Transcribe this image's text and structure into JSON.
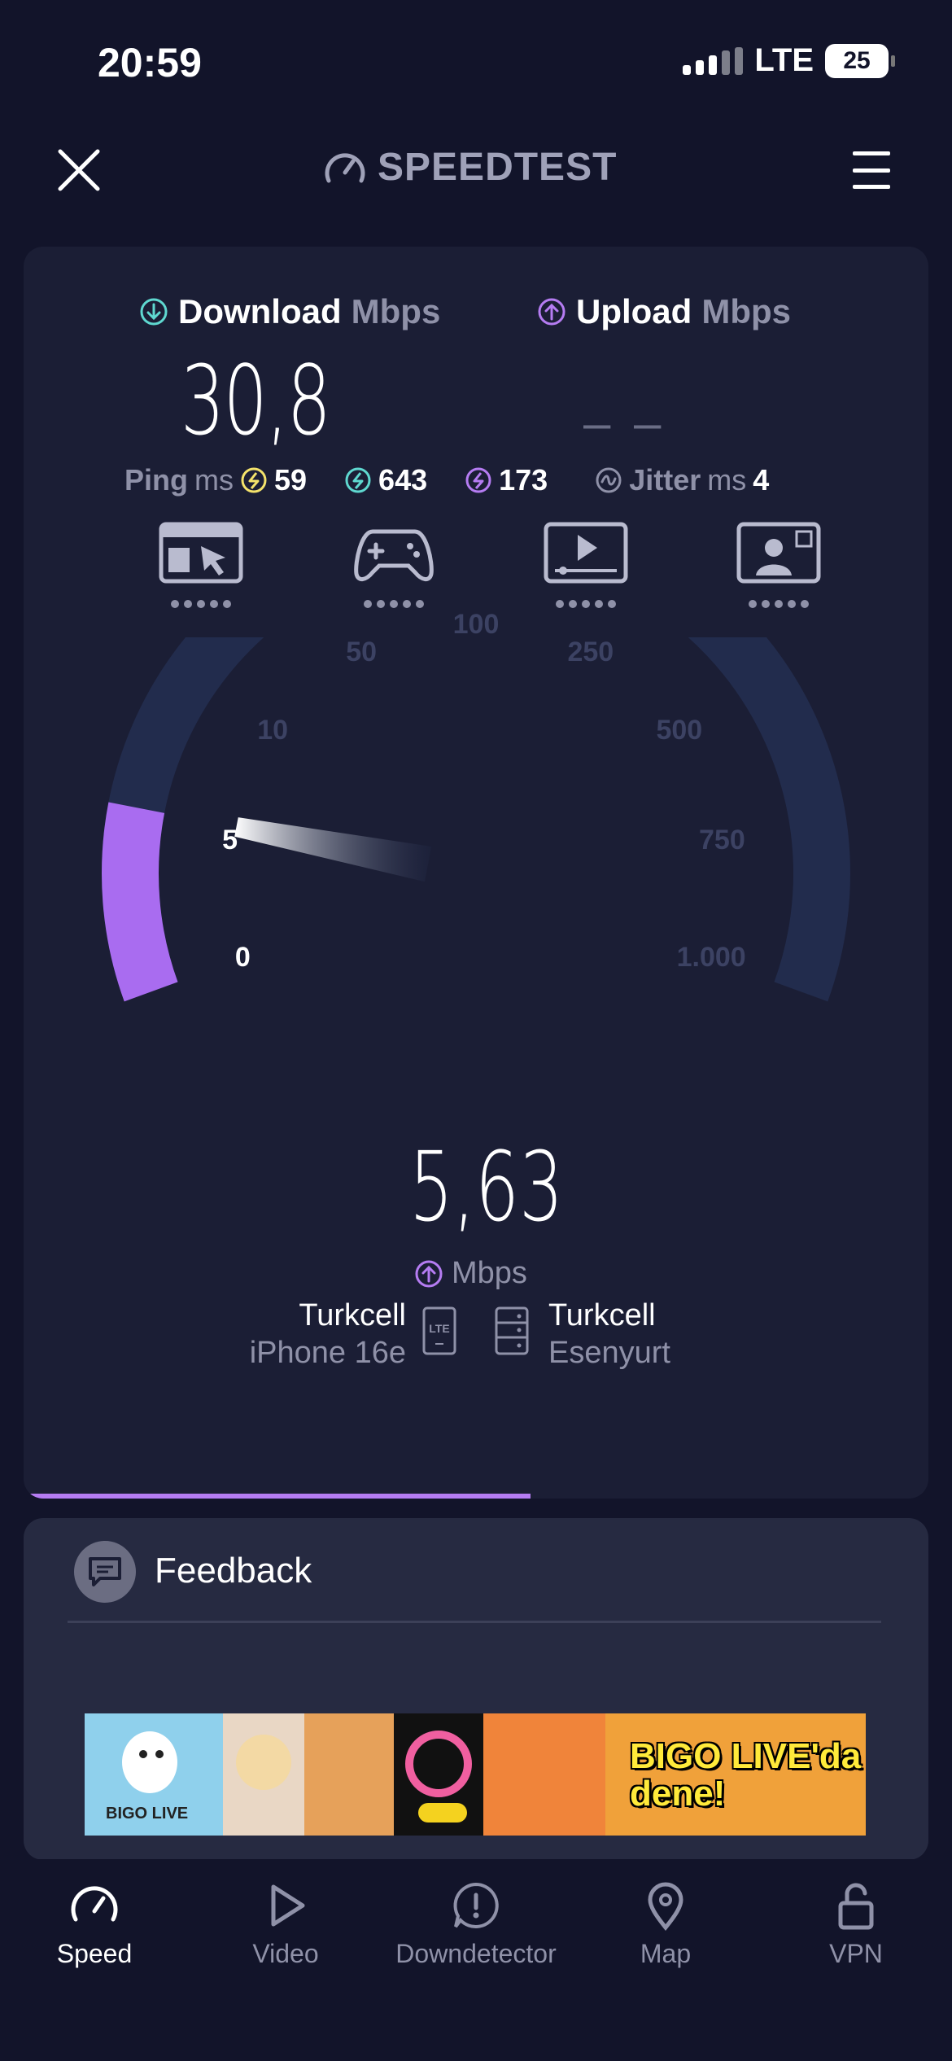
{
  "status_bar": {
    "time": "20:59",
    "network": "LTE",
    "battery": "25"
  },
  "header": {
    "title": "SPEEDTEST"
  },
  "results": {
    "download_label": "Download",
    "download_unit": "Mbps",
    "download_value": "30,8",
    "upload_label": "Upload",
    "upload_unit": "Mbps",
    "upload_value": "– –",
    "ping_label": "Ping",
    "ping_unit": "ms",
    "ping_idle": "59",
    "ping_download": "643",
    "ping_upload": "173",
    "jitter_label": "Jitter",
    "jitter_unit": "ms",
    "jitter_value": "4"
  },
  "gauge": {
    "scale_labels": [
      "0",
      "5",
      "10",
      "50",
      "100",
      "250",
      "500",
      "750",
      "1.000"
    ],
    "needle_value": 5.63,
    "current_value": "5,63",
    "current_unit": "Mbps",
    "fill_color": "#a96cf0",
    "track_color": "#222c4d"
  },
  "connection": {
    "provider": "Turkcell",
    "device": "iPhone 16e",
    "badge": "LTE",
    "server_name": "Turkcell",
    "server_location": "Esenyurt"
  },
  "test_progress_percent": 56,
  "feedback": {
    "label": "Feedback"
  },
  "ad": {
    "brand": "BIGO LIVE",
    "headline_1": "BIGO LIVE'da",
    "headline_2": "dene!"
  },
  "tabs": [
    {
      "label": "Speed",
      "icon": "speedometer-icon",
      "active": true
    },
    {
      "label": "Video",
      "icon": "play-icon",
      "active": false
    },
    {
      "label": "Downdetector",
      "icon": "alert-icon",
      "active": false
    },
    {
      "label": "Map",
      "icon": "map-pin-icon",
      "active": false
    },
    {
      "label": "VPN",
      "icon": "unlock-icon",
      "active": false
    }
  ],
  "colors": {
    "background": "#12142a",
    "card": "#1b1e35",
    "download_accent": "#5fd8d0",
    "upload_accent": "#b57cf2",
    "ping_accent": "#f4e36b"
  }
}
